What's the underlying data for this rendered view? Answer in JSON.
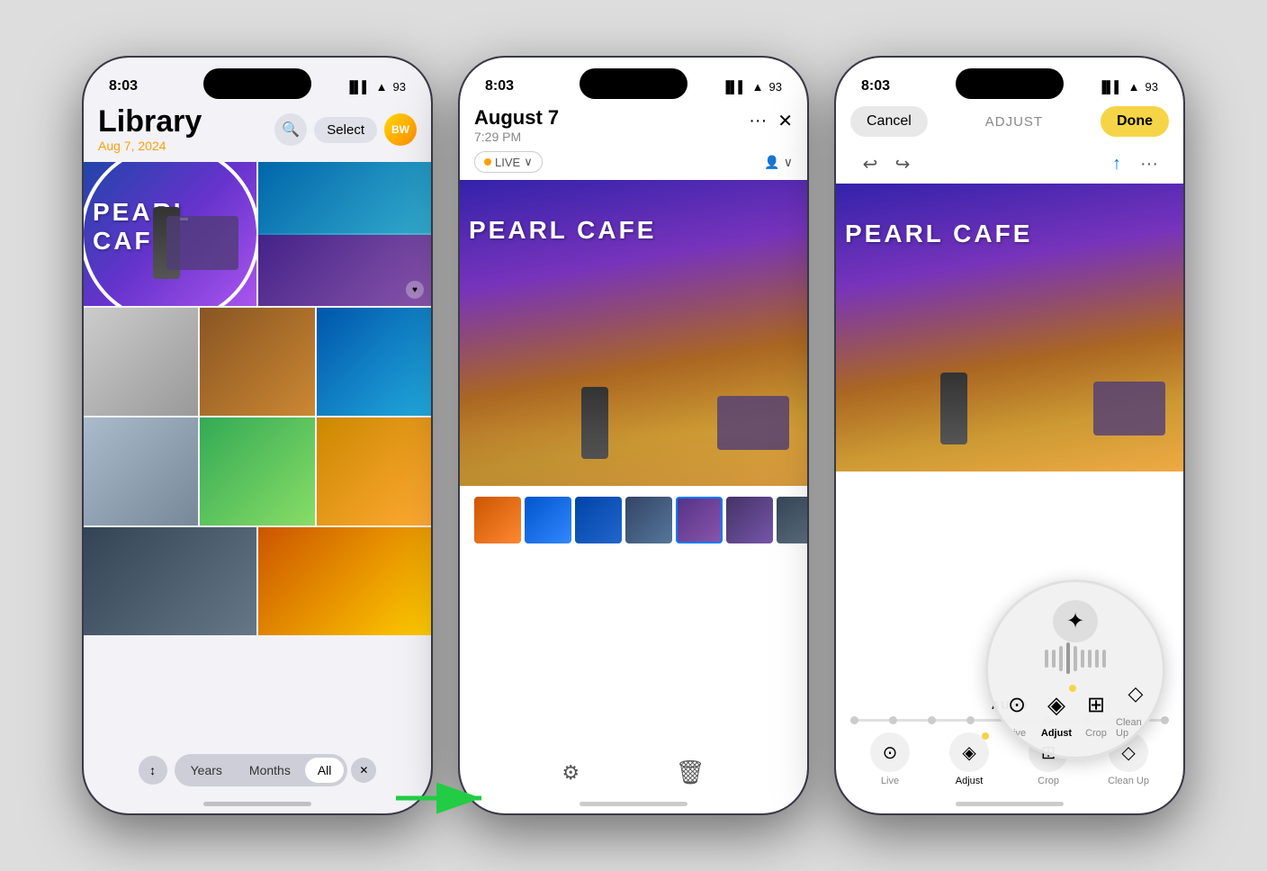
{
  "phone1": {
    "status": {
      "time": "8:03",
      "signal": "●●●",
      "wifi": "WiFi",
      "battery": "93"
    },
    "header": {
      "title": "Library",
      "date": "Aug 7, 2024",
      "search_label": "🔍",
      "select_label": "Select",
      "avatar_label": "BW"
    },
    "bottom_bar": {
      "years_label": "Years",
      "months_label": "Months",
      "all_label": "All",
      "sort_icon": "↕",
      "close_icon": "✕"
    }
  },
  "phone2": {
    "status": {
      "time": "8:03",
      "signal": "●●●",
      "battery": "93"
    },
    "header": {
      "title": "August 7",
      "subtitle": "7:29 PM",
      "more_icon": "···",
      "close_icon": "✕"
    },
    "meta": {
      "live_label": "LIVE",
      "chevron": "∨",
      "people_icon": "👤",
      "people_chevron": "∨"
    },
    "toolbar": {
      "edit_icon": "≡",
      "delete_icon": "🗑"
    }
  },
  "phone3": {
    "status": {
      "time": "8:03",
      "signal": "●●●",
      "battery": "93"
    },
    "top_bar": {
      "cancel_label": "Cancel",
      "adjust_label": "ADJUST",
      "done_label": "Done",
      "undo_icon": "↩",
      "redo_icon": "↪",
      "share_icon": "↑",
      "more_icon": "···"
    },
    "tools": {
      "auto_label": "AUTO",
      "live_label": "Live",
      "adjust_label": "Adjust",
      "crop_label": "Crop",
      "cleanup_label": "Clean Up"
    }
  },
  "arrow": {
    "color": "#22cc44"
  }
}
